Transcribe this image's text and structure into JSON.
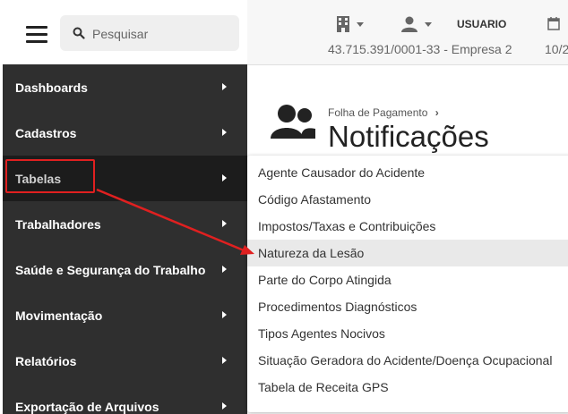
{
  "search": {
    "placeholder": "Pesquisar"
  },
  "header": {
    "user_label": "USUARIO",
    "company": "43.715.391/0001-33 - Empresa 2",
    "date_fragment": "10/2"
  },
  "sidebar": {
    "items": [
      {
        "label": "Dashboards"
      },
      {
        "label": "Cadastros"
      },
      {
        "label": "Tabelas",
        "active": true
      },
      {
        "label": "Trabalhadores"
      },
      {
        "label": "Saúde e Segurança do Trabalho"
      },
      {
        "label": "Movimentação"
      },
      {
        "label": "Relatórios"
      },
      {
        "label": "Exportação de Arquivos"
      }
    ]
  },
  "page": {
    "breadcrumb": "Folha de Pagamento",
    "breadcrumb_sep": "›",
    "title": "Notificações"
  },
  "submenu": {
    "items": [
      {
        "label": "Agente Causador do Acidente"
      },
      {
        "label": "Código Afastamento"
      },
      {
        "label": "Impostos/Taxas e Contribuições"
      },
      {
        "label": "Natureza da Lesão",
        "hovered": true
      },
      {
        "label": "Parte do Corpo Atingida"
      },
      {
        "label": "Procedimentos Diagnósticos"
      },
      {
        "label": "Tipos Agentes Nocivos"
      },
      {
        "label": "Situação Geradora do Acidente/Doença Ocupacional"
      },
      {
        "label": "Tabela de Receita GPS"
      }
    ]
  },
  "annotation": {
    "color": "#e02020"
  },
  "icons": [
    "menu-icon",
    "search-icon",
    "building-icon",
    "user-icon",
    "calendar-icon",
    "users-icon",
    "chevron-right-icon"
  ]
}
